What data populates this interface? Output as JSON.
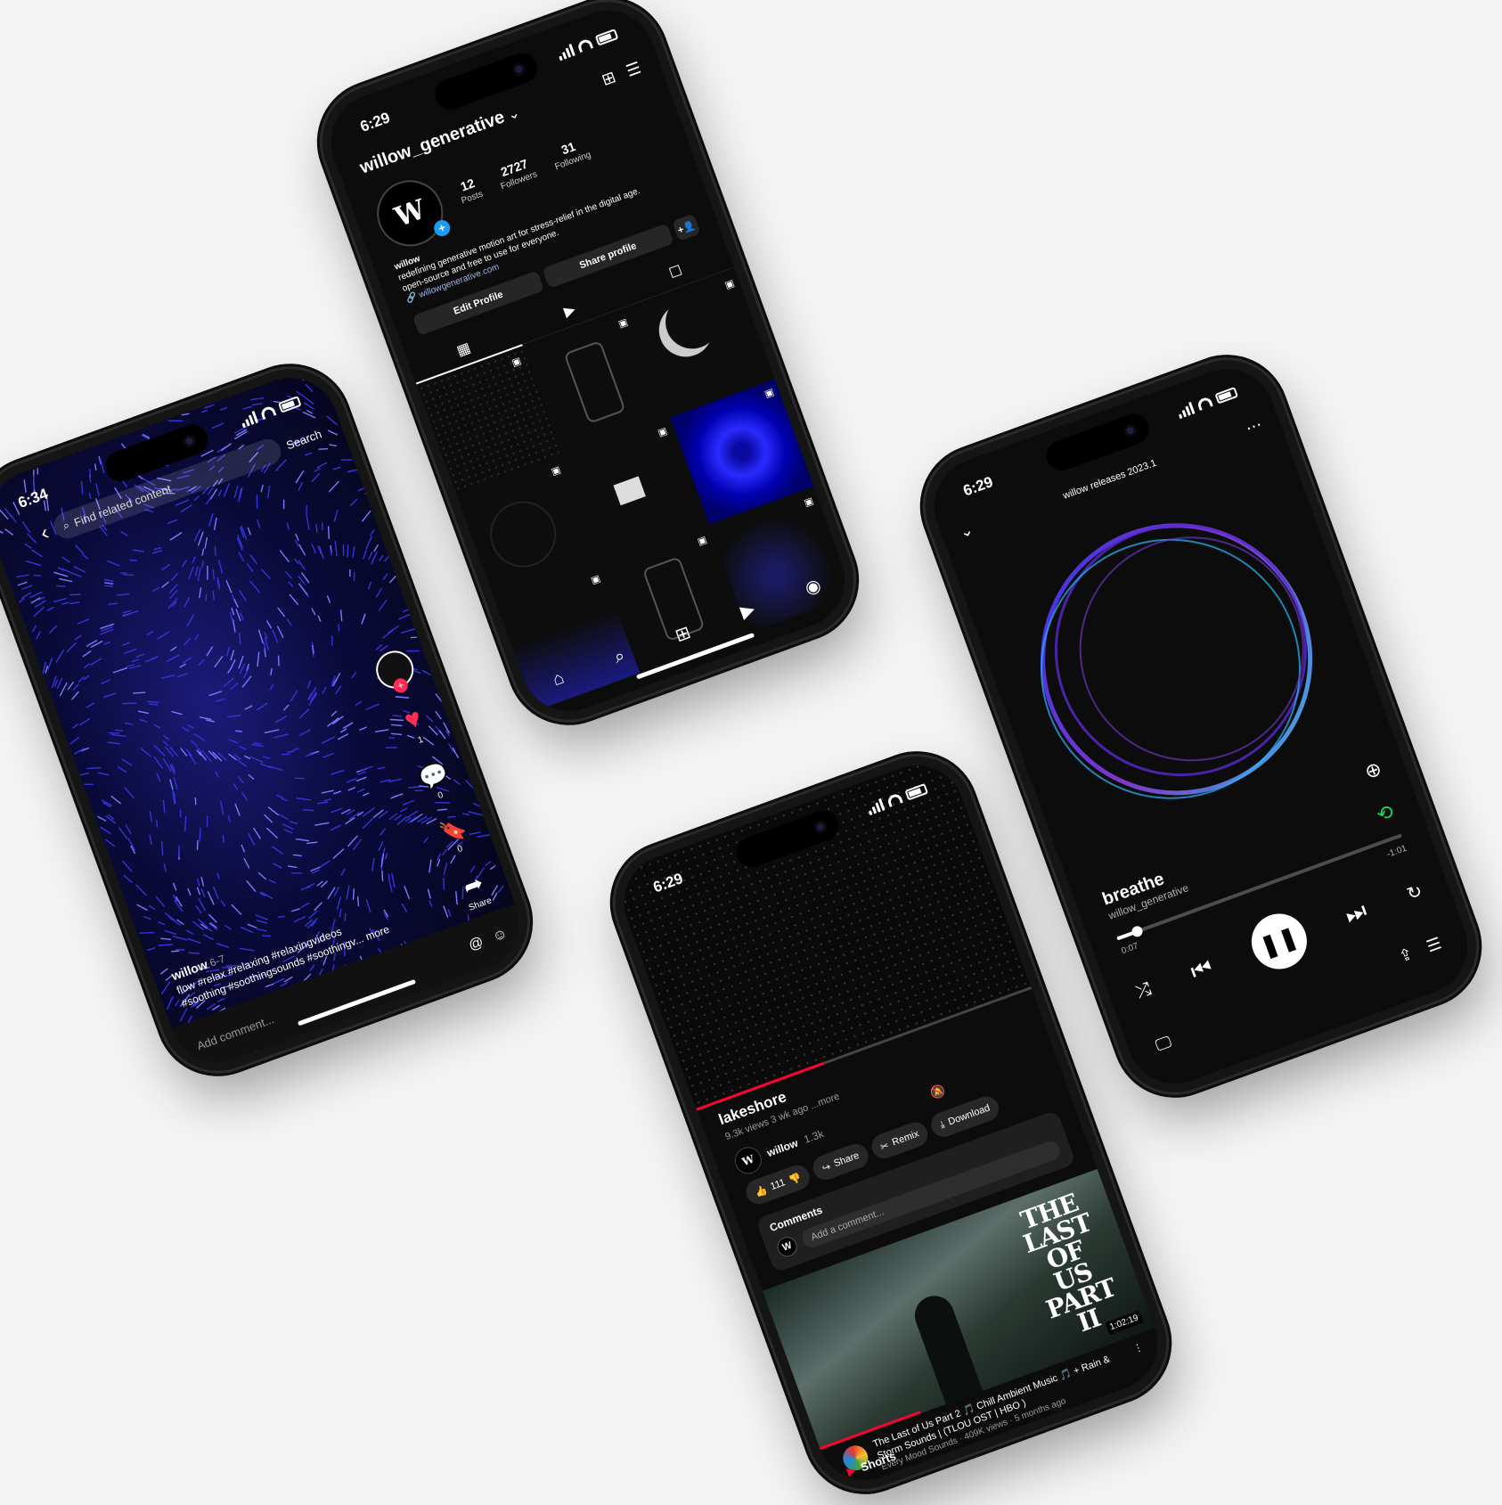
{
  "tiktok": {
    "time": "6:34",
    "search_placeholder": "Find related content",
    "search_button": "Search",
    "likes": "1",
    "comments": "0",
    "saves": "0",
    "share_label": "Share",
    "username": "willow",
    "date": "6-7",
    "caption_line1": "flow #relax #relaxing #relaxingvideos",
    "caption_line2": "#soothing #soothingsounds #soothingv... more",
    "add_comment": "Add comment..."
  },
  "instagram": {
    "time": "6:29",
    "username": "willow_generative",
    "posts_count": "12",
    "posts_label": "Posts",
    "followers_count": "2727",
    "followers_label": "Followers",
    "following_count": "31",
    "following_label": "Following",
    "bio_name": "willow",
    "bio_line1": "redefining generative motion art for stress-relief in the digital age.",
    "bio_line2": "open-source and free to use for everyone.",
    "link": "willowgenerative.com",
    "edit_profile": "Edit Profile",
    "share_profile": "Share profile"
  },
  "youtube": {
    "time": "6:29",
    "title": "lakeshore",
    "meta": "9.3k views  3 wk ago  ...more",
    "channel": "willow",
    "subs": "1.3k",
    "likes": "111",
    "share": "Share",
    "remix": "Remix",
    "download": "Download",
    "comments_label": "Comments",
    "add_comment": "Add a comment...",
    "rec_poster": "THE LAST OF US PART II",
    "rec_duration": "1:02:19",
    "rec_title": "The Last of Us Part 2 🎵 Chill Ambient Music 🎵 + Rain & Storm Sounds | (TLOU OST | HBO )",
    "rec_meta": "Every Mood Sounds · 409K views · 5 months ago",
    "shorts": "Shorts"
  },
  "spotify": {
    "time": "6:29",
    "playlist": "willow releases 2023.1",
    "track": "breathe",
    "artist": "willow_generative",
    "elapsed": "0:07",
    "remaining": "-1:01",
    "progress": 0.07
  }
}
